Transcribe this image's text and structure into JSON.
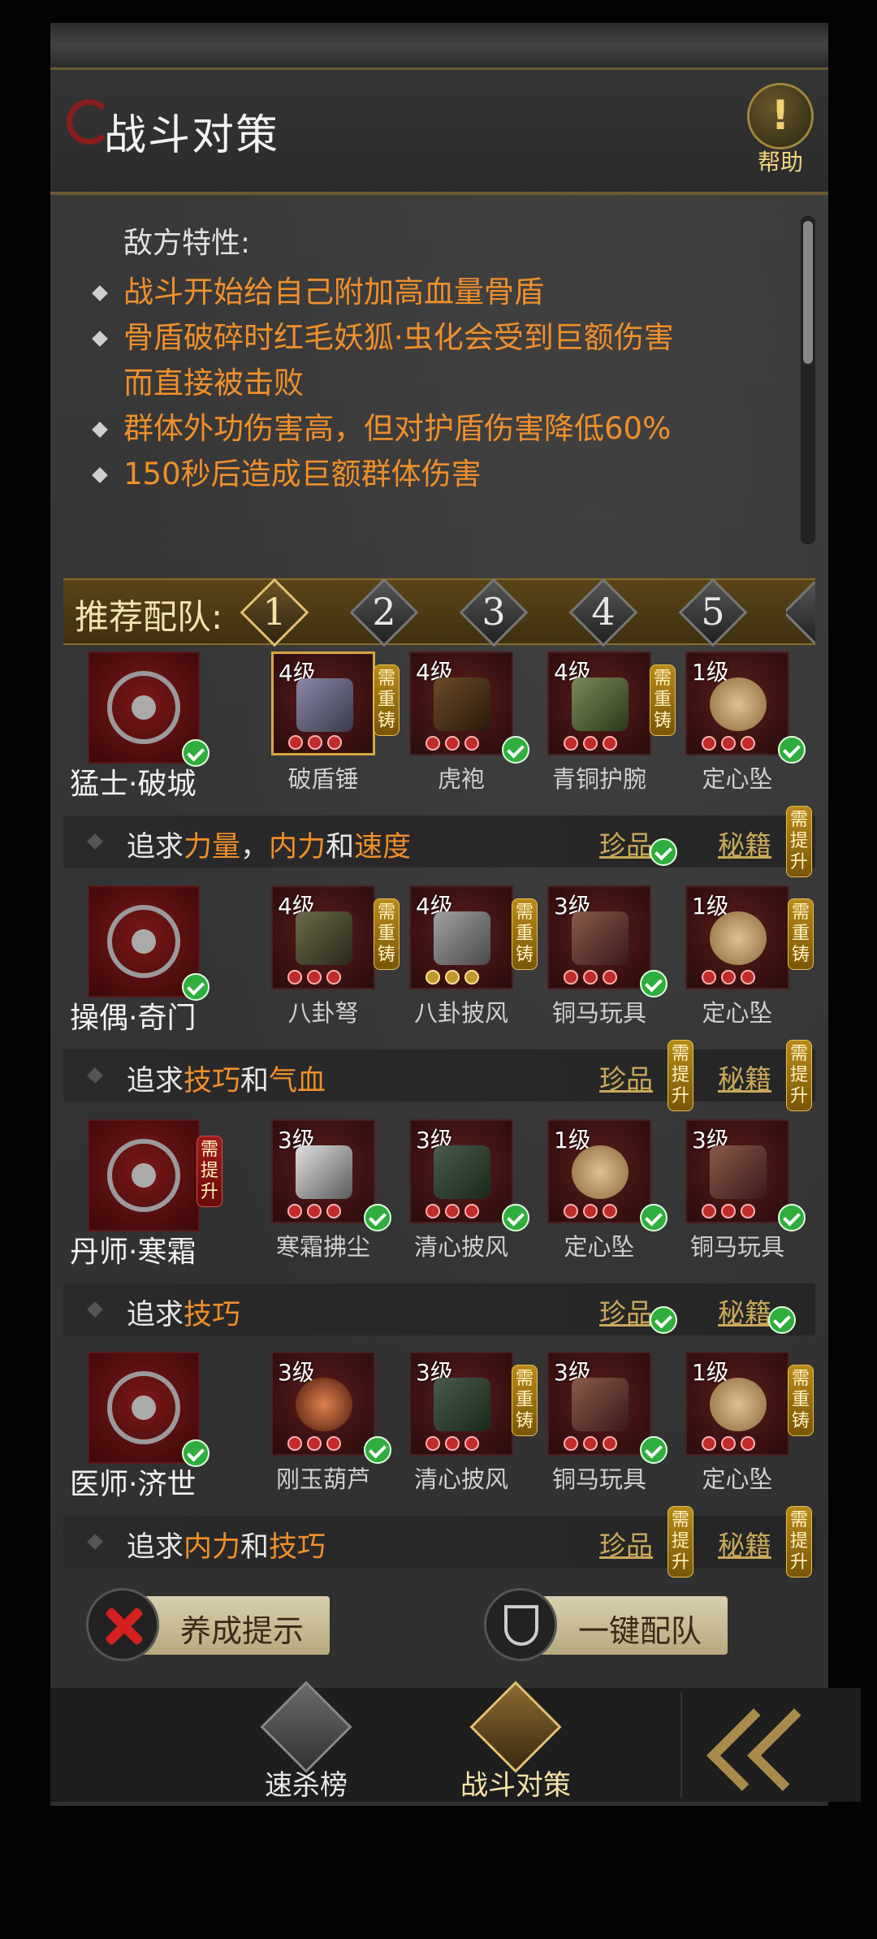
{
  "header": {
    "title": "战斗对策",
    "help_label": "帮助",
    "help_glyph": "!"
  },
  "traits": {
    "heading": "敌方特性:",
    "items": [
      "战斗开始给自己附加高血量骨盾",
      "骨盾破碎时红毛妖狐·虫化会受到巨额伤害",
      "而直接被击败",
      "群体外功伤害高，但对护盾伤害降低60%",
      "150秒后造成巨额群体伤害"
    ]
  },
  "team": {
    "label": "推荐配队:",
    "tabs": [
      "1",
      "2",
      "3",
      "4",
      "5"
    ],
    "active_tab": "1"
  },
  "badges": {
    "reforge": "需重铸",
    "upgrade": "需提升",
    "treasure": "珍品",
    "manual": "秘籍"
  },
  "heroes": [
    {
      "name": "猛士·破城",
      "items": [
        {
          "level": "4级",
          "name": "破盾锤"
        },
        {
          "level": "4级",
          "name": "虎袍"
        },
        {
          "level": "4级",
          "name": "青铜护腕"
        },
        {
          "level": "1级",
          "name": "定心坠"
        }
      ],
      "pursuit": {
        "prefix": "追求",
        "a": "力量",
        "sep1": "，",
        "b": "内力",
        "sep2": "和",
        "c": "速度"
      }
    },
    {
      "name": "操偶·奇门",
      "items": [
        {
          "level": "4级",
          "name": "八卦弩"
        },
        {
          "level": "4级",
          "name": "八卦披风"
        },
        {
          "level": "3级",
          "name": "铜马玩具"
        },
        {
          "level": "1级",
          "name": "定心坠"
        }
      ],
      "pursuit": {
        "prefix": "追求",
        "a": "技巧",
        "sep1": "和",
        "b": "气血"
      }
    },
    {
      "name": "丹师·寒霜",
      "items": [
        {
          "level": "3级",
          "name": "寒霜拂尘"
        },
        {
          "level": "3级",
          "name": "清心披风"
        },
        {
          "level": "1级",
          "name": "定心坠"
        },
        {
          "level": "3级",
          "name": "铜马玩具"
        }
      ],
      "pursuit": {
        "prefix": "追求",
        "a": "技巧"
      }
    },
    {
      "name": "医师·济世",
      "items": [
        {
          "level": "3级",
          "name": "刚玉葫芦"
        },
        {
          "level": "3级",
          "name": "清心披风"
        },
        {
          "level": "3级",
          "name": "铜马玩具"
        },
        {
          "level": "1级",
          "name": "定心坠"
        }
      ],
      "pursuit": {
        "prefix": "追求",
        "a": "内力",
        "sep1": "和",
        "b": "技巧"
      }
    }
  ],
  "actions": {
    "tips_label": "养成提示",
    "auto_team_label": "一键配队"
  },
  "nav": {
    "kill_rank": "速杀榜",
    "battle": "战斗对策"
  },
  "colors": {
    "highlight": "#f08f2a",
    "gold": "#c9a85a",
    "check": "#2fae3e"
  }
}
